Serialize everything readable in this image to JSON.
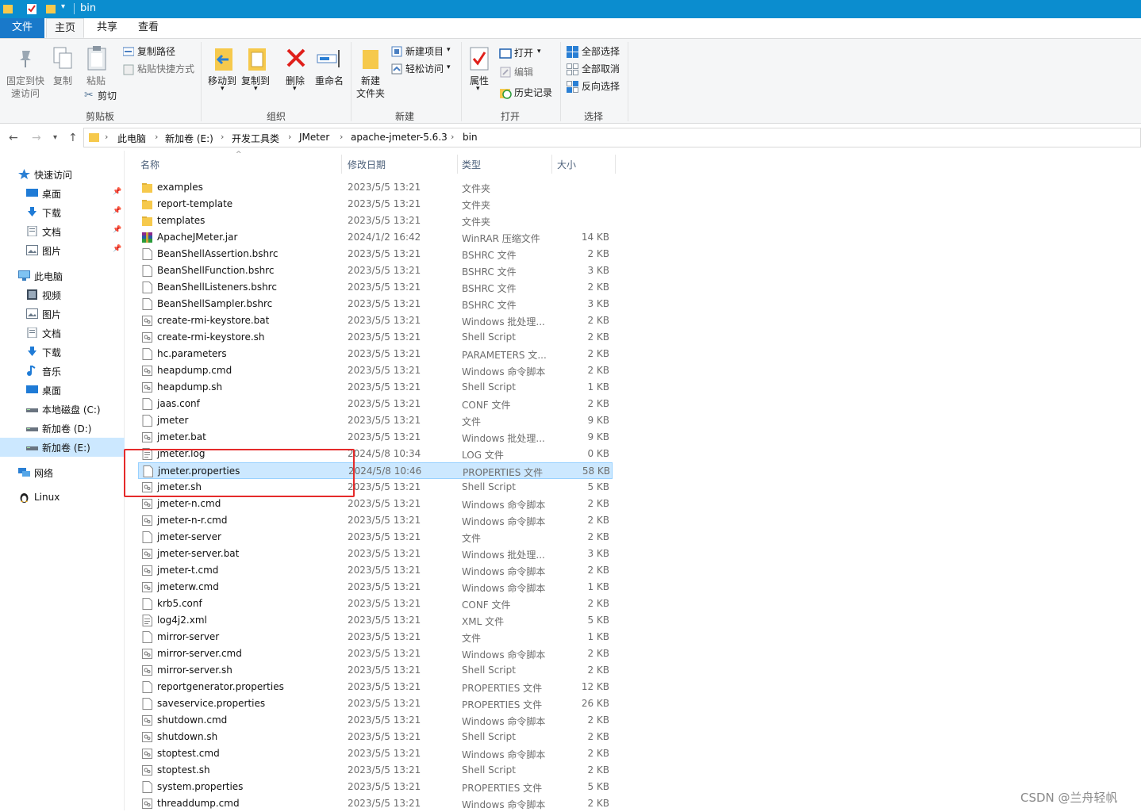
{
  "window": {
    "title": "bin"
  },
  "tabs": [
    "文件",
    "主页",
    "共享",
    "查看"
  ],
  "ribbon": {
    "clipboard": {
      "pin_label_1": "固定到快",
      "pin_label_2": "速访问",
      "copy": "复制",
      "paste": "粘贴",
      "copy_path": "复制路径",
      "paste_shortcut": "粘贴快捷方式",
      "cut": "剪切",
      "group": "剪贴板"
    },
    "organize": {
      "move_to": "移动到",
      "copy_to": "复制到",
      "delete": "删除",
      "rename": "重命名",
      "group": "组织"
    },
    "new": {
      "new_folder_1": "新建",
      "new_folder_2": "文件夹",
      "new_item": "新建项目",
      "easy_access": "轻松访问",
      "group": "新建"
    },
    "open": {
      "properties": "属性",
      "open": "打开",
      "edit": "编辑",
      "history": "历史记录",
      "group": "打开"
    },
    "select": {
      "select_all": "全部选择",
      "select_none": "全部取消",
      "invert": "反向选择",
      "group": "选择"
    }
  },
  "address": {
    "crumbs": [
      "此电脑",
      "新加卷 (E:)",
      "开发工具类",
      "JMeter",
      "apache-jmeter-5.6.3",
      "bin"
    ]
  },
  "sidebar": [
    {
      "label": "快速访问",
      "icon": "star-icon",
      "pinned": false
    },
    {
      "label": "桌面",
      "icon": "desktop-icon",
      "pinned": true
    },
    {
      "label": "下载",
      "icon": "download-icon",
      "pinned": true
    },
    {
      "label": "文档",
      "icon": "document-icon",
      "pinned": true
    },
    {
      "label": "图片",
      "icon": "picture-icon",
      "pinned": true
    },
    {
      "label": "此电脑",
      "icon": "computer-icon",
      "pinned": false
    },
    {
      "label": "视频",
      "icon": "video-icon",
      "pinned": false
    },
    {
      "label": "图片",
      "icon": "picture-icon",
      "pinned": false
    },
    {
      "label": "文档",
      "icon": "document-icon",
      "pinned": false
    },
    {
      "label": "下载",
      "icon": "download-icon",
      "pinned": false
    },
    {
      "label": "音乐",
      "icon": "music-icon",
      "pinned": false
    },
    {
      "label": "桌面",
      "icon": "desktop-icon",
      "pinned": false
    },
    {
      "label": "本地磁盘 (C:)",
      "icon": "drive-icon",
      "pinned": false
    },
    {
      "label": "新加卷 (D:)",
      "icon": "drive-icon",
      "pinned": false
    },
    {
      "label": "新加卷 (E:)",
      "icon": "drive-icon",
      "pinned": false,
      "selected": true
    },
    {
      "label": "网络",
      "icon": "network-icon",
      "pinned": false
    },
    {
      "label": "Linux",
      "icon": "linux-icon",
      "pinned": false
    }
  ],
  "columns": {
    "name": "名称",
    "date": "修改日期",
    "type": "类型",
    "size": "大小"
  },
  "files": [
    {
      "name": "examples",
      "date": "2023/5/5 13:21",
      "type": "文件夹",
      "size": "",
      "icon": "folder"
    },
    {
      "name": "report-template",
      "date": "2023/5/5 13:21",
      "type": "文件夹",
      "size": "",
      "icon": "folder"
    },
    {
      "name": "templates",
      "date": "2023/5/5 13:21",
      "type": "文件夹",
      "size": "",
      "icon": "folder"
    },
    {
      "name": "ApacheJMeter.jar",
      "date": "2024/1/2 16:42",
      "type": "WinRAR 压缩文件",
      "size": "14 KB",
      "icon": "archive"
    },
    {
      "name": "BeanShellAssertion.bshrc",
      "date": "2023/5/5 13:21",
      "type": "BSHRC 文件",
      "size": "2 KB",
      "icon": "file"
    },
    {
      "name": "BeanShellFunction.bshrc",
      "date": "2023/5/5 13:21",
      "type": "BSHRC 文件",
      "size": "3 KB",
      "icon": "file"
    },
    {
      "name": "BeanShellListeners.bshrc",
      "date": "2023/5/5 13:21",
      "type": "BSHRC 文件",
      "size": "2 KB",
      "icon": "file"
    },
    {
      "name": "BeanShellSampler.bshrc",
      "date": "2023/5/5 13:21",
      "type": "BSHRC 文件",
      "size": "3 KB",
      "icon": "file"
    },
    {
      "name": "create-rmi-keystore.bat",
      "date": "2023/5/5 13:21",
      "type": "Windows 批处理...",
      "size": "2 KB",
      "icon": "script"
    },
    {
      "name": "create-rmi-keystore.sh",
      "date": "2023/5/5 13:21",
      "type": "Shell Script",
      "size": "2 KB",
      "icon": "script"
    },
    {
      "name": "hc.parameters",
      "date": "2023/5/5 13:21",
      "type": "PARAMETERS 文...",
      "size": "2 KB",
      "icon": "file"
    },
    {
      "name": "heapdump.cmd",
      "date": "2023/5/5 13:21",
      "type": "Windows 命令脚本",
      "size": "2 KB",
      "icon": "script"
    },
    {
      "name": "heapdump.sh",
      "date": "2023/5/5 13:21",
      "type": "Shell Script",
      "size": "1 KB",
      "icon": "script"
    },
    {
      "name": "jaas.conf",
      "date": "2023/5/5 13:21",
      "type": "CONF 文件",
      "size": "2 KB",
      "icon": "file"
    },
    {
      "name": "jmeter",
      "date": "2023/5/5 13:21",
      "type": "文件",
      "size": "9 KB",
      "icon": "file"
    },
    {
      "name": "jmeter.bat",
      "date": "2023/5/5 13:21",
      "type": "Windows 批处理...",
      "size": "9 KB",
      "icon": "script"
    },
    {
      "name": "jmeter.log",
      "date": "2024/5/8 10:34",
      "type": "LOG 文件",
      "size": "0 KB",
      "icon": "log"
    },
    {
      "name": "jmeter.properties",
      "date": "2024/5/8 10:46",
      "type": "PROPERTIES 文件",
      "size": "58 KB",
      "icon": "file",
      "selected": true
    },
    {
      "name": "jmeter.sh",
      "date": "2023/5/5 13:21",
      "type": "Shell Script",
      "size": "5 KB",
      "icon": "script"
    },
    {
      "name": "jmeter-n.cmd",
      "date": "2023/5/5 13:21",
      "type": "Windows 命令脚本",
      "size": "2 KB",
      "icon": "script"
    },
    {
      "name": "jmeter-n-r.cmd",
      "date": "2023/5/5 13:21",
      "type": "Windows 命令脚本",
      "size": "2 KB",
      "icon": "script"
    },
    {
      "name": "jmeter-server",
      "date": "2023/5/5 13:21",
      "type": "文件",
      "size": "2 KB",
      "icon": "file"
    },
    {
      "name": "jmeter-server.bat",
      "date": "2023/5/5 13:21",
      "type": "Windows 批处理...",
      "size": "3 KB",
      "icon": "script"
    },
    {
      "name": "jmeter-t.cmd",
      "date": "2023/5/5 13:21",
      "type": "Windows 命令脚本",
      "size": "2 KB",
      "icon": "script"
    },
    {
      "name": "jmeterw.cmd",
      "date": "2023/5/5 13:21",
      "type": "Windows 命令脚本",
      "size": "1 KB",
      "icon": "script"
    },
    {
      "name": "krb5.conf",
      "date": "2023/5/5 13:21",
      "type": "CONF 文件",
      "size": "2 KB",
      "icon": "file"
    },
    {
      "name": "log4j2.xml",
      "date": "2023/5/5 13:21",
      "type": "XML 文件",
      "size": "5 KB",
      "icon": "log"
    },
    {
      "name": "mirror-server",
      "date": "2023/5/5 13:21",
      "type": "文件",
      "size": "1 KB",
      "icon": "file"
    },
    {
      "name": "mirror-server.cmd",
      "date": "2023/5/5 13:21",
      "type": "Windows 命令脚本",
      "size": "2 KB",
      "icon": "script"
    },
    {
      "name": "mirror-server.sh",
      "date": "2023/5/5 13:21",
      "type": "Shell Script",
      "size": "2 KB",
      "icon": "script"
    },
    {
      "name": "reportgenerator.properties",
      "date": "2023/5/5 13:21",
      "type": "PROPERTIES 文件",
      "size": "12 KB",
      "icon": "file"
    },
    {
      "name": "saveservice.properties",
      "date": "2023/5/5 13:21",
      "type": "PROPERTIES 文件",
      "size": "26 KB",
      "icon": "file"
    },
    {
      "name": "shutdown.cmd",
      "date": "2023/5/5 13:21",
      "type": "Windows 命令脚本",
      "size": "2 KB",
      "icon": "script"
    },
    {
      "name": "shutdown.sh",
      "date": "2023/5/5 13:21",
      "type": "Shell Script",
      "size": "2 KB",
      "icon": "script"
    },
    {
      "name": "stoptest.cmd",
      "date": "2023/5/5 13:21",
      "type": "Windows 命令脚本",
      "size": "2 KB",
      "icon": "script"
    },
    {
      "name": "stoptest.sh",
      "date": "2023/5/5 13:21",
      "type": "Shell Script",
      "size": "2 KB",
      "icon": "script"
    },
    {
      "name": "system.properties",
      "date": "2023/5/5 13:21",
      "type": "PROPERTIES 文件",
      "size": "5 KB",
      "icon": "file"
    },
    {
      "name": "threaddump.cmd",
      "date": "2023/5/5 13:21",
      "type": "Windows 命令脚本",
      "size": "2 KB",
      "icon": "script"
    }
  ],
  "watermark": "CSDN @兰舟轻帆",
  "colors": {
    "titlebar": "#0b8dcf",
    "file_tab": "#1979ca",
    "selection": "#cce8ff",
    "highlight_box": "#e52b2b",
    "folder": "#f6c94c"
  }
}
